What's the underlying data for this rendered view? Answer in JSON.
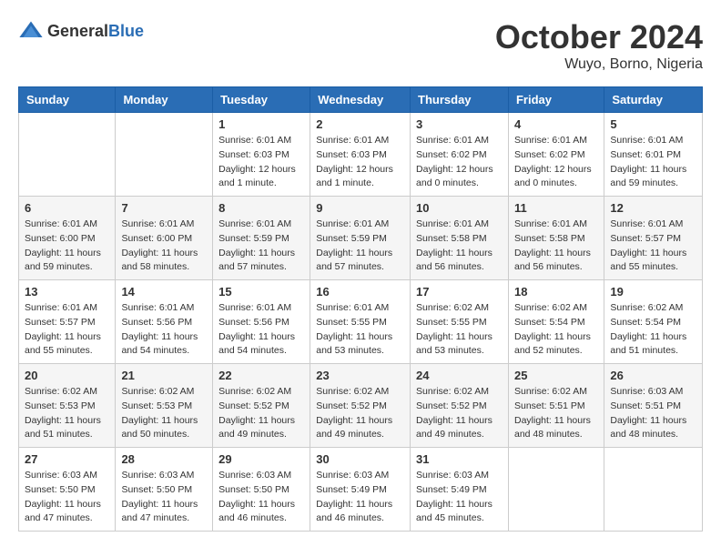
{
  "logo": {
    "text_general": "General",
    "text_blue": "Blue"
  },
  "header": {
    "month": "October 2024",
    "location": "Wuyo, Borno, Nigeria"
  },
  "weekdays": [
    "Sunday",
    "Monday",
    "Tuesday",
    "Wednesday",
    "Thursday",
    "Friday",
    "Saturday"
  ],
  "weeks": [
    [
      {
        "day": "",
        "info": ""
      },
      {
        "day": "",
        "info": ""
      },
      {
        "day": "1",
        "info": "Sunrise: 6:01 AM\nSunset: 6:03 PM\nDaylight: 12 hours and 1 minute."
      },
      {
        "day": "2",
        "info": "Sunrise: 6:01 AM\nSunset: 6:03 PM\nDaylight: 12 hours and 1 minute."
      },
      {
        "day": "3",
        "info": "Sunrise: 6:01 AM\nSunset: 6:02 PM\nDaylight: 12 hours and 0 minutes."
      },
      {
        "day": "4",
        "info": "Sunrise: 6:01 AM\nSunset: 6:02 PM\nDaylight: 12 hours and 0 minutes."
      },
      {
        "day": "5",
        "info": "Sunrise: 6:01 AM\nSunset: 6:01 PM\nDaylight: 11 hours and 59 minutes."
      }
    ],
    [
      {
        "day": "6",
        "info": "Sunrise: 6:01 AM\nSunset: 6:00 PM\nDaylight: 11 hours and 59 minutes."
      },
      {
        "day": "7",
        "info": "Sunrise: 6:01 AM\nSunset: 6:00 PM\nDaylight: 11 hours and 58 minutes."
      },
      {
        "day": "8",
        "info": "Sunrise: 6:01 AM\nSunset: 5:59 PM\nDaylight: 11 hours and 57 minutes."
      },
      {
        "day": "9",
        "info": "Sunrise: 6:01 AM\nSunset: 5:59 PM\nDaylight: 11 hours and 57 minutes."
      },
      {
        "day": "10",
        "info": "Sunrise: 6:01 AM\nSunset: 5:58 PM\nDaylight: 11 hours and 56 minutes."
      },
      {
        "day": "11",
        "info": "Sunrise: 6:01 AM\nSunset: 5:58 PM\nDaylight: 11 hours and 56 minutes."
      },
      {
        "day": "12",
        "info": "Sunrise: 6:01 AM\nSunset: 5:57 PM\nDaylight: 11 hours and 55 minutes."
      }
    ],
    [
      {
        "day": "13",
        "info": "Sunrise: 6:01 AM\nSunset: 5:57 PM\nDaylight: 11 hours and 55 minutes."
      },
      {
        "day": "14",
        "info": "Sunrise: 6:01 AM\nSunset: 5:56 PM\nDaylight: 11 hours and 54 minutes."
      },
      {
        "day": "15",
        "info": "Sunrise: 6:01 AM\nSunset: 5:56 PM\nDaylight: 11 hours and 54 minutes."
      },
      {
        "day": "16",
        "info": "Sunrise: 6:01 AM\nSunset: 5:55 PM\nDaylight: 11 hours and 53 minutes."
      },
      {
        "day": "17",
        "info": "Sunrise: 6:02 AM\nSunset: 5:55 PM\nDaylight: 11 hours and 53 minutes."
      },
      {
        "day": "18",
        "info": "Sunrise: 6:02 AM\nSunset: 5:54 PM\nDaylight: 11 hours and 52 minutes."
      },
      {
        "day": "19",
        "info": "Sunrise: 6:02 AM\nSunset: 5:54 PM\nDaylight: 11 hours and 51 minutes."
      }
    ],
    [
      {
        "day": "20",
        "info": "Sunrise: 6:02 AM\nSunset: 5:53 PM\nDaylight: 11 hours and 51 minutes."
      },
      {
        "day": "21",
        "info": "Sunrise: 6:02 AM\nSunset: 5:53 PM\nDaylight: 11 hours and 50 minutes."
      },
      {
        "day": "22",
        "info": "Sunrise: 6:02 AM\nSunset: 5:52 PM\nDaylight: 11 hours and 49 minutes."
      },
      {
        "day": "23",
        "info": "Sunrise: 6:02 AM\nSunset: 5:52 PM\nDaylight: 11 hours and 49 minutes."
      },
      {
        "day": "24",
        "info": "Sunrise: 6:02 AM\nSunset: 5:52 PM\nDaylight: 11 hours and 49 minutes."
      },
      {
        "day": "25",
        "info": "Sunrise: 6:02 AM\nSunset: 5:51 PM\nDaylight: 11 hours and 48 minutes."
      },
      {
        "day": "26",
        "info": "Sunrise: 6:03 AM\nSunset: 5:51 PM\nDaylight: 11 hours and 48 minutes."
      }
    ],
    [
      {
        "day": "27",
        "info": "Sunrise: 6:03 AM\nSunset: 5:50 PM\nDaylight: 11 hours and 47 minutes."
      },
      {
        "day": "28",
        "info": "Sunrise: 6:03 AM\nSunset: 5:50 PM\nDaylight: 11 hours and 47 minutes."
      },
      {
        "day": "29",
        "info": "Sunrise: 6:03 AM\nSunset: 5:50 PM\nDaylight: 11 hours and 46 minutes."
      },
      {
        "day": "30",
        "info": "Sunrise: 6:03 AM\nSunset: 5:49 PM\nDaylight: 11 hours and 46 minutes."
      },
      {
        "day": "31",
        "info": "Sunrise: 6:03 AM\nSunset: 5:49 PM\nDaylight: 11 hours and 45 minutes."
      },
      {
        "day": "",
        "info": ""
      },
      {
        "day": "",
        "info": ""
      }
    ]
  ]
}
